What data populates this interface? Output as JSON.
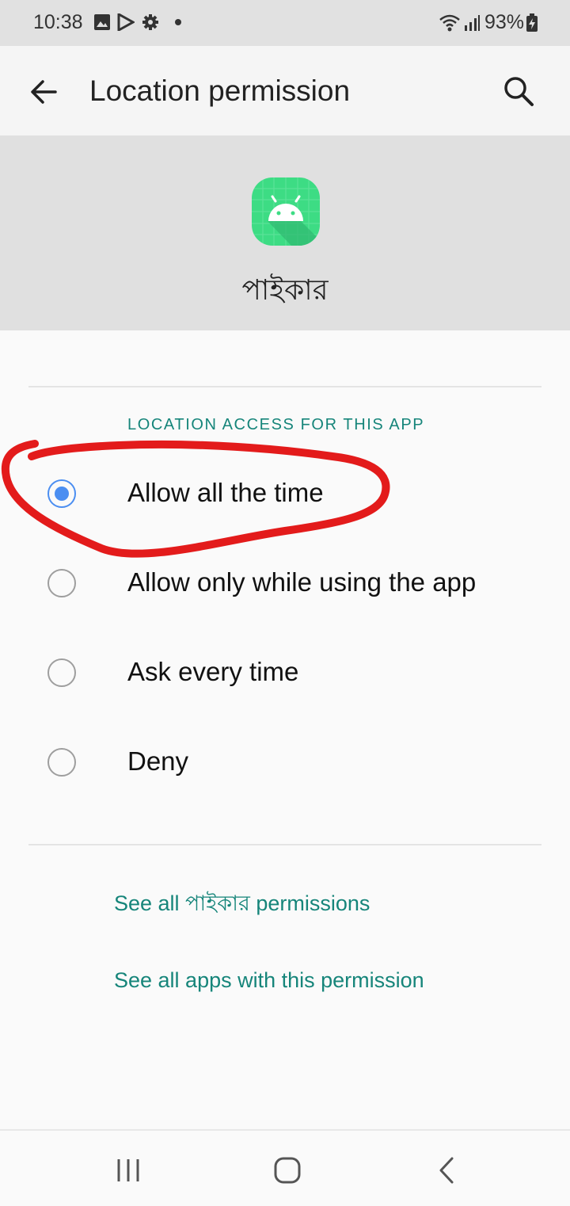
{
  "status_bar": {
    "time": "10:38",
    "battery": "93%",
    "icons": [
      "gallery-icon",
      "play-store-icon",
      "settings-gear-icon",
      "notification-dot-icon",
      "wifi-icon",
      "signal-icon",
      "battery-charging-icon"
    ]
  },
  "app_bar": {
    "title": "Location permission",
    "back_icon": "arrow-back-icon",
    "search_icon": "search-icon"
  },
  "app_header": {
    "app_name": "পাইকার",
    "icon": "android-app-icon",
    "icon_color": "#3ddc84"
  },
  "section": {
    "header": "LOCATION ACCESS FOR THIS APP",
    "options": [
      {
        "label": "Allow all the time",
        "selected": true
      },
      {
        "label": "Allow only while using the app",
        "selected": false
      },
      {
        "label": "Ask every time",
        "selected": false
      },
      {
        "label": "Deny",
        "selected": false
      }
    ]
  },
  "links": {
    "app_permissions": "See all পাইকার permissions",
    "apps_with_permission": "See all apps with this permission"
  },
  "nav_bar": {
    "recents_icon": "recents-icon",
    "home_icon": "home-icon",
    "back_icon": "nav-back-icon"
  },
  "colors": {
    "accent": "#16857a",
    "radio_selected": "#4b8ef1",
    "annotation": "#e31b1b"
  }
}
